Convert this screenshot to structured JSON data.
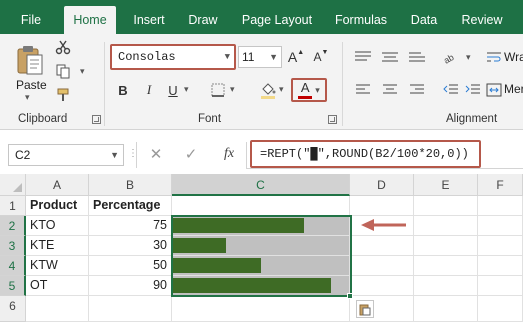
{
  "tabs": [
    "File",
    "Home",
    "Insert",
    "Draw",
    "Page Layout",
    "Formulas",
    "Data",
    "Review"
  ],
  "active_tab": "Home",
  "clipboard": {
    "paste_label": "Paste",
    "group_label": "Clipboard"
  },
  "font": {
    "name": "Consolas",
    "size": "11",
    "bold": "B",
    "italic": "I",
    "underline": "U",
    "font_color_letter": "A",
    "grow": "A",
    "shrink": "A",
    "group_label": "Font",
    "font_color": "#c00000"
  },
  "wrap_text_label": "Wra",
  "merge_label": "Mer",
  "alignment": {
    "group_label": "Alignment"
  },
  "formula_bar": {
    "name_box": "C2",
    "fx": "fx",
    "formula_prefix": "=REPT(\"",
    "formula_block": "█",
    "formula_suffix": "\",ROUND(B2/100*20,0))"
  },
  "columns": [
    "A",
    "B",
    "C",
    "D",
    "E",
    "F"
  ],
  "rows": [
    "1",
    "2",
    "3",
    "4",
    "5",
    "6"
  ],
  "sheet": {
    "headers": {
      "a1": "Product",
      "b1": "Percentage"
    },
    "data": [
      {
        "product": "KTO",
        "percentage": "75",
        "fill": 0.75
      },
      {
        "product": "KTE",
        "percentage": "30",
        "fill": 0.3
      },
      {
        "product": "KTW",
        "percentage": "50",
        "fill": 0.5
      },
      {
        "product": "OT",
        "percentage": "90",
        "fill": 0.9
      }
    ]
  },
  "colors": {
    "brand_green": "#1e7145",
    "bar_green": "#3e6b25",
    "bar_track": "#c0c0c0",
    "highlight_border": "#b5584a",
    "annotation_arrow": "#c0655a"
  },
  "icons": [
    "cut-icon",
    "copy-icon",
    "format-painter-icon",
    "paste-icon",
    "fill-color-icon",
    "font-color-icon",
    "cancel-icon",
    "check-icon",
    "fx-icon",
    "paste-options-icon",
    "arrow-annotation-icon"
  ]
}
